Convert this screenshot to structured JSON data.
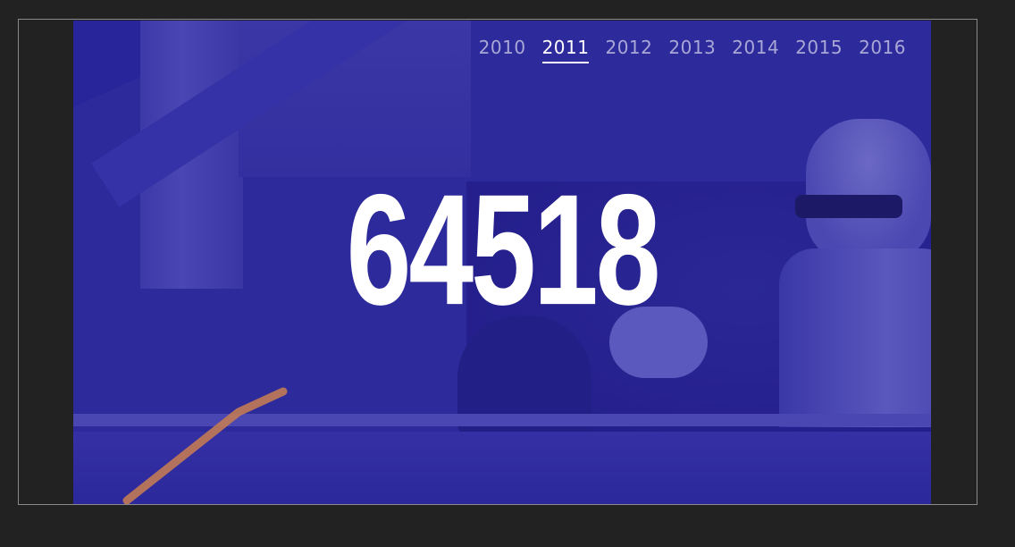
{
  "years": [
    "2010",
    "2011",
    "2012",
    "2013",
    "2014",
    "2015",
    "2016"
  ],
  "active_year_index": 1,
  "value": "64518",
  "colors": {
    "overlay": "#2d2a9c",
    "accent_stroke": "#c27a55",
    "text": "#ffffff",
    "inactive_year": "#a9a7d6"
  }
}
